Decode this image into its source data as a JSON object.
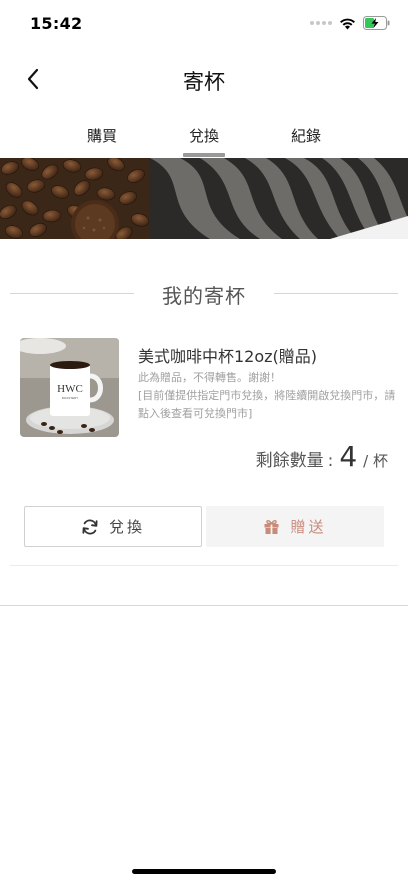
{
  "status_bar": {
    "time": "15:42"
  },
  "nav": {
    "title": "寄杯"
  },
  "tabs": [
    {
      "label": "購買",
      "active": false
    },
    {
      "label": "兌換",
      "active": true
    },
    {
      "label": "紀錄",
      "active": false
    }
  ],
  "section": {
    "title": "我的寄杯"
  },
  "product": {
    "name": "美式咖啡中杯12oz(贈品)",
    "note_line1": "此為贈品，不得轉售。謝謝！",
    "note_line2": "[目前僅提供指定門市兌換，將陸續開啟兌換門市，請點入後查看可兌換門市]",
    "image_brand": "HWC",
    "image_brand_sub": "ROASTERY"
  },
  "remaining": {
    "label": "剩餘數量",
    "colon": ":",
    "count": "4",
    "unit": "/ 杯"
  },
  "actions": {
    "exchange_label": "兌換",
    "gift_label": "贈送"
  },
  "colors": {
    "gift_accent": "#c98a7a",
    "tab_indicator": "#999999"
  }
}
